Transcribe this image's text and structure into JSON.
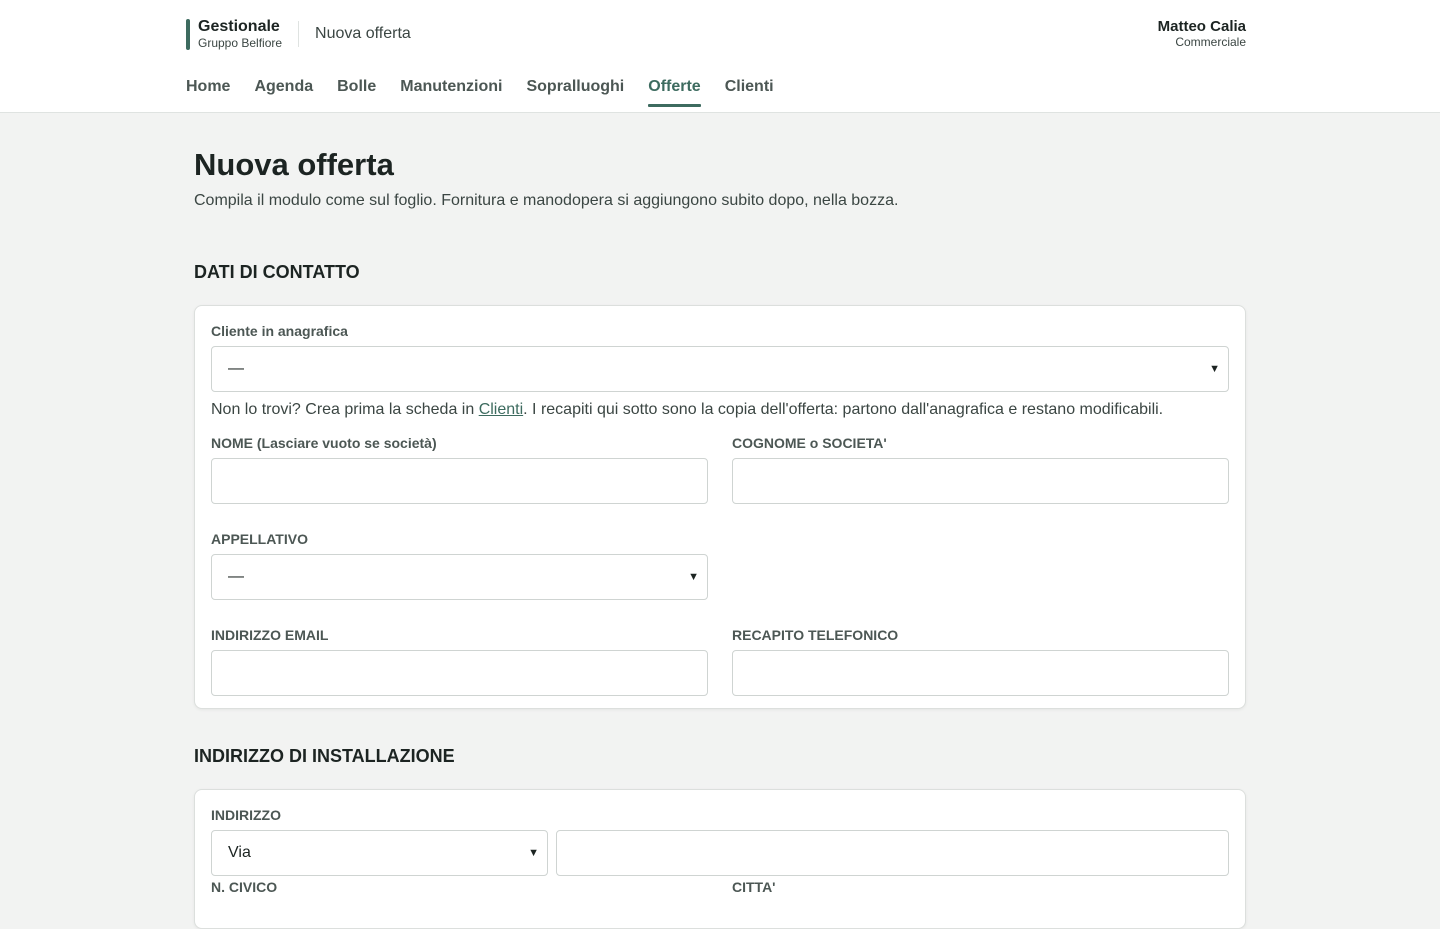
{
  "brand": {
    "name": "Gestionale",
    "sub": "Gruppo Belfiore",
    "crumb": "Nuova offerta"
  },
  "user": {
    "name": "Matteo Calia",
    "role": "Commerciale"
  },
  "nav": {
    "items": [
      "Home",
      "Agenda",
      "Bolle",
      "Manutenzioni",
      "Sopralluoghi",
      "Offerte",
      "Clienti"
    ],
    "active": "Offerte"
  },
  "page": {
    "title": "Nuova offerta",
    "subtitle": "Compila il modulo come sul foglio. Fornitura e manodopera si aggiungono subito dopo, nella bozza."
  },
  "contact": {
    "section_title": "DATI DI CONTATTO",
    "cliente_label": "Cliente in anagrafica",
    "cliente_value": "—",
    "hint_pre": "Non lo trovi? Crea prima la scheda in ",
    "hint_link": "Clienti",
    "hint_post": ". I recapiti qui sotto sono la copia dell'offerta: partono dall'anagrafica e restano modificabili.",
    "nome_label": "NOME (Lasciare vuoto se società)",
    "nome_value": "",
    "cognome_label": "COGNOME o SOCIETA'",
    "cognome_value": "",
    "appellativo_label": "APPELLATIVO",
    "appellativo_value": "—",
    "email_label": "INDIRIZZO EMAIL",
    "email_value": "",
    "telefono_label": "RECAPITO TELEFONICO",
    "telefono_value": ""
  },
  "installation": {
    "section_title": "INDIRIZZO DI INSTALLAZIONE",
    "indirizzo_label": "INDIRIZZO",
    "tipo_value": "Via",
    "via_value": "",
    "civico_label": "N. CIVICO",
    "citta_label": "CITTA'"
  },
  "icons": {
    "chevron": "chevron-down-icon"
  },
  "colors": {
    "accent": "#3d6b5f",
    "background": "#f2f3f2"
  }
}
